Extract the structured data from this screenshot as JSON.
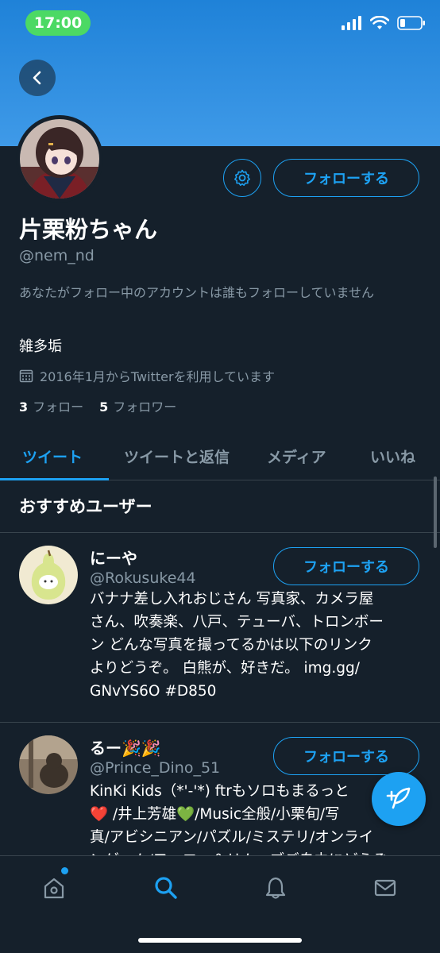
{
  "status_bar": {
    "time": "17:00"
  },
  "profile": {
    "name": "片栗粉ちゃん",
    "handle": "@nem_nd",
    "notice": "あなたがフォロー中のアカウントは誰もフォローしていません",
    "bio": "雑多垢",
    "joined": "2016年1月からTwitterを利用しています",
    "following_count": "3",
    "following_label": "フォロー",
    "followers_count": "5",
    "followers_label": "フォロワー",
    "follow_button": "フォローする"
  },
  "tabs": [
    {
      "label": "ツイート"
    },
    {
      "label": "ツイートと返信"
    },
    {
      "label": "メディア"
    },
    {
      "label": "いいね"
    }
  ],
  "recommended": {
    "title": "おすすめユーザー",
    "users": [
      {
        "name": "にーや",
        "handle": "@Rokusuke44",
        "follow_label": "フォローする",
        "bio_lines": [
          "バナナ差し入れおじさん 写真家、カメラ屋",
          "さん、吹奏楽、八戸、テューバ、トロンボー",
          "ン どんな写真を撮ってるかは以下のリンク",
          "よりどうぞ。 白熊が、好きだ。 img.gg/",
          "GNvYS6O #D850"
        ]
      },
      {
        "name": "るー🎉🎉",
        "handle": "@Prince_Dino_51",
        "follow_label": "フォローする",
        "bio_lines": [
          "KinKi Kids（*'-'*) ftrもソロもまるっと",
          "❤️ /井上芳雄💚/Music全般/小栗旬/写",
          "真/アビシニアン/パズル/ミステリ/オンライ",
          "ンゲーム/フォロー＆リムーブご自由にどうぞ"
        ]
      }
    ]
  },
  "colors": {
    "accent": "#1da1f2",
    "background": "#15202b",
    "secondary_text": "#8899a6",
    "banner": "#3f9ae8"
  }
}
